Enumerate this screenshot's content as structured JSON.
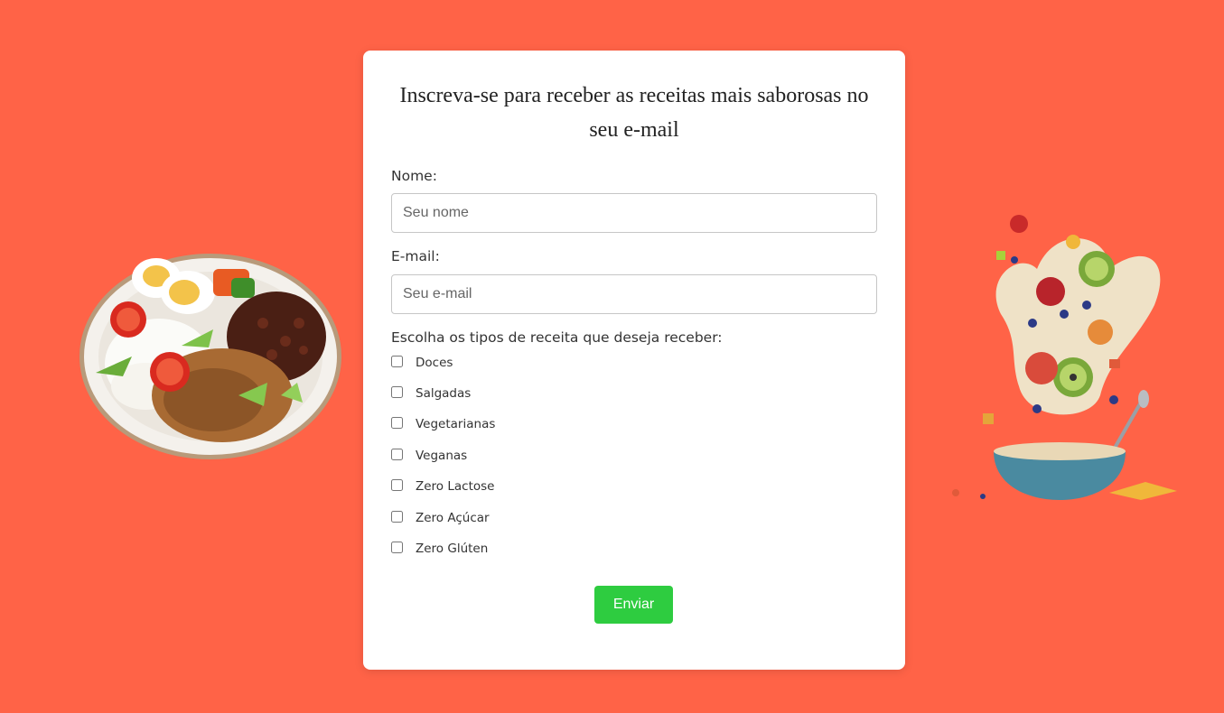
{
  "form": {
    "title": "Inscreva-se para receber as receitas mais saborosas no seu e-mail",
    "name_label": "Nome:",
    "name_placeholder": "Seu nome",
    "name_value": "",
    "email_label": "E-mail:",
    "email_placeholder": "Seu e-mail",
    "email_value": "",
    "recipe_types_label": "Escolha os tipos de receita que deseja receber:",
    "recipe_types": [
      {
        "label": "Doces",
        "checked": false
      },
      {
        "label": "Salgadas",
        "checked": false
      },
      {
        "label": "Vegetarianas",
        "checked": false
      },
      {
        "label": "Veganas",
        "checked": false
      },
      {
        "label": "Zero Lactose",
        "checked": false
      },
      {
        "label": "Zero Açúcar",
        "checked": false
      },
      {
        "label": "Zero Glúten",
        "checked": false
      }
    ],
    "submit_label": "Enviar"
  },
  "colors": {
    "background": "#ff6347",
    "card": "#ffffff",
    "submit_button": "#2ecc40"
  }
}
